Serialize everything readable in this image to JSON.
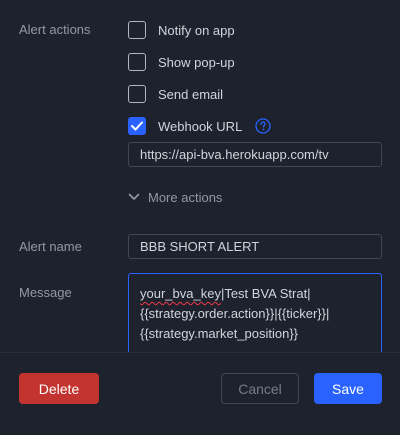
{
  "alert_actions": {
    "label": "Alert actions",
    "options": [
      {
        "label": "Notify on app",
        "checked": false
      },
      {
        "label": "Show pop-up",
        "checked": false
      },
      {
        "label": "Send email",
        "checked": false
      },
      {
        "label": "Webhook URL",
        "checked": true
      }
    ],
    "webhook_url": "https://api-bva.herokuapp.com/tv",
    "more_actions_label": "More actions"
  },
  "alert_name": {
    "label": "Alert name",
    "value": "BBB SHORT ALERT"
  },
  "message": {
    "label": "Message",
    "spellcheck_word": "your_bva_key",
    "line1_rest": "|Test BVA Strat|",
    "line2": "{{strategy.order.action}}|{{ticker}}|",
    "line3": "{{strategy.market_position}}"
  },
  "buttons": {
    "delete": "Delete",
    "cancel": "Cancel",
    "save": "Save"
  },
  "colors": {
    "background": "#1e222d",
    "accent": "#2962ff",
    "danger": "#c3332f"
  },
  "icons": {
    "checkmark": "checkmark-icon",
    "help": "question-circle-icon",
    "chevron": "chevron-down-icon"
  }
}
